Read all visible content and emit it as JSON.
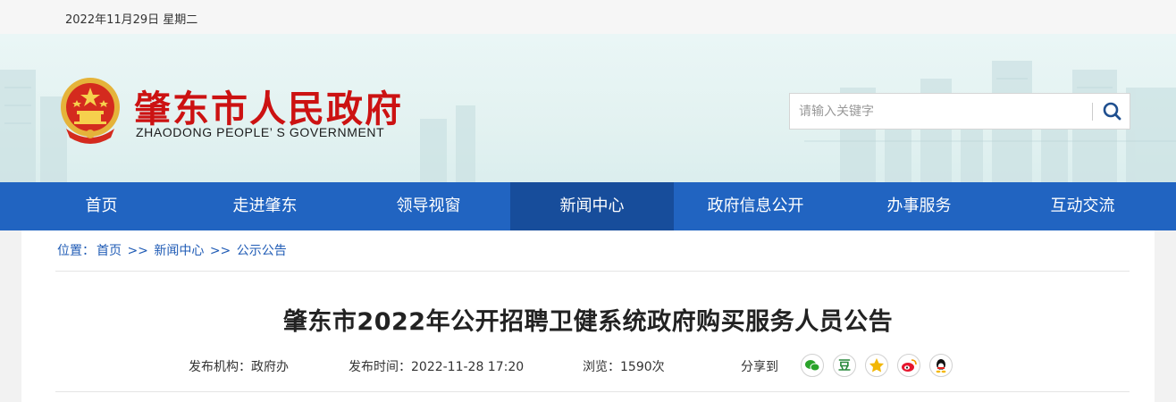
{
  "topbar": {
    "date": "2022年11月29日 星期二"
  },
  "header": {
    "title_cn": "肇东市人民政府",
    "title_en": "ZHAODONG PEOPLE’ S GOVERNMENT",
    "emblem_icon": "national-emblem-icon"
  },
  "search": {
    "placeholder": "请输入关键字",
    "icon": "search-icon"
  },
  "nav": {
    "items": [
      {
        "label": "首页"
      },
      {
        "label": "走进肇东"
      },
      {
        "label": "领导视窗"
      },
      {
        "label": "新闻中心"
      },
      {
        "label": "政府信息公开"
      },
      {
        "label": "办事服务"
      },
      {
        "label": "互动交流"
      }
    ],
    "active_index": 3
  },
  "breadcrumb": {
    "prefix": "位置：",
    "items": [
      "首页",
      "新闻中心",
      "公示公告"
    ],
    "separator": ">>"
  },
  "article": {
    "title": "肇东市2022年公开招聘卫健系统政府购买服务人员公告",
    "publisher_label": "发布机构：",
    "publisher": "政府办",
    "time_label": "发布时间：",
    "time": "2022-11-28 17:20",
    "views_label": "浏览：",
    "views": "1590次",
    "share_label": "分享到"
  },
  "share": [
    "wechat-icon",
    "douban-icon",
    "qzone-icon",
    "weibo-icon",
    "qq-icon"
  ],
  "colors": {
    "brand_red": "#cc1212",
    "nav_blue": "#2164c1",
    "nav_active": "#174d9b",
    "link_blue": "#1f5bb5"
  }
}
